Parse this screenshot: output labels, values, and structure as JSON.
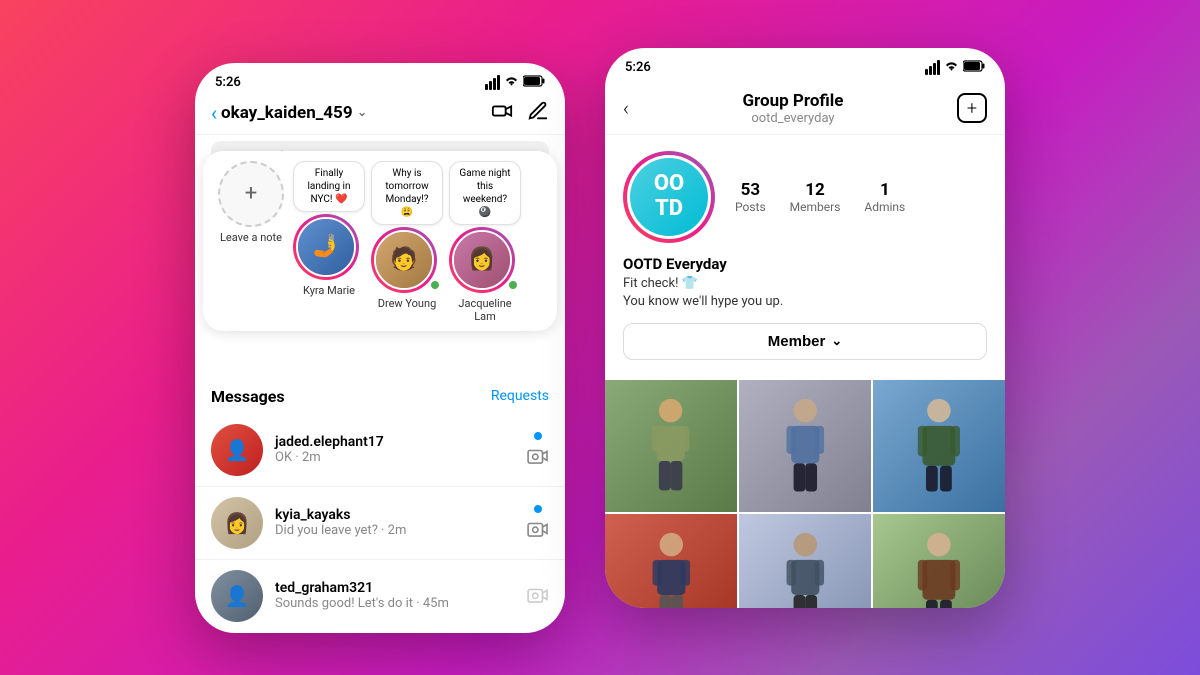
{
  "background": {
    "gradient": "linear-gradient(135deg, #f9425f 0%, #e91e8c 30%, #c71cc0 60%, #9b59b6 80%, #7c4ddb 100%)"
  },
  "left_phone": {
    "status_bar": {
      "time": "5:26",
      "signal": "●●●",
      "wifi": "WiFi",
      "battery": "Battery"
    },
    "nav": {
      "back_label": "<",
      "title": "okay_kaiden_459",
      "chevron": "∨",
      "video_icon": "video",
      "edit_icon": "edit"
    },
    "search_placeholder": "Search",
    "stories": [
      {
        "id": "self",
        "label": "Leave a note",
        "note": null,
        "has_add": true,
        "online": false
      },
      {
        "id": "kyra",
        "label": "Kyra Marie",
        "note": "Finally landing in NYC! ❤️",
        "has_add": false,
        "online": false,
        "emoji": "🤳"
      },
      {
        "id": "drew",
        "label": "Drew Young",
        "note": "Why is tomorrow Monday!? 😩",
        "has_add": false,
        "online": true,
        "emoji": "🧑"
      },
      {
        "id": "jacqueline",
        "label": "Jacqueline Lam",
        "note": "Game night this weekend? 🎱",
        "has_add": false,
        "online": true,
        "emoji": "👩"
      }
    ],
    "messages": {
      "title": "Messages",
      "requests_label": "Requests",
      "items": [
        {
          "username": "jaded.elephant17",
          "preview": "OK · 2m",
          "unread": true,
          "emoji": "👤"
        },
        {
          "username": "kyia_kayaks",
          "preview": "Did you leave yet? · 2m",
          "unread": true,
          "emoji": "👩"
        },
        {
          "username": "ted_graham321",
          "preview": "Sounds good! Let's do it · 45m",
          "unread": false,
          "emoji": "👤"
        }
      ]
    }
  },
  "right_phone": {
    "status_bar": {
      "time": "5:26",
      "signal": "●●●",
      "wifi": "WiFi",
      "battery": "Battery"
    },
    "header": {
      "back_label": "<",
      "title": "Group Profile",
      "username": "ootd_everyday",
      "add_icon": "plus-box"
    },
    "group": {
      "avatar_text": "OO\nTD",
      "name": "OOTD Everyday",
      "bio_line1": "Fit check! 👕",
      "bio_line2": "You know we'll hype you up.",
      "stats": [
        {
          "value": "53",
          "label": "Posts"
        },
        {
          "value": "12",
          "label": "Members"
        },
        {
          "value": "1",
          "label": "Admins"
        }
      ],
      "member_button": "Member",
      "chevron": "∨"
    },
    "photo_grid": [
      {
        "id": "p1",
        "color": "#a8c898"
      },
      {
        "id": "p2",
        "color": "#c0c0d0"
      },
      {
        "id": "p3",
        "color": "#8ab4d4"
      },
      {
        "id": "p4",
        "color": "#e08060"
      },
      {
        "id": "p5",
        "color": "#d0d8e8"
      },
      {
        "id": "p6",
        "color": "#b8d0a0"
      }
    ]
  }
}
